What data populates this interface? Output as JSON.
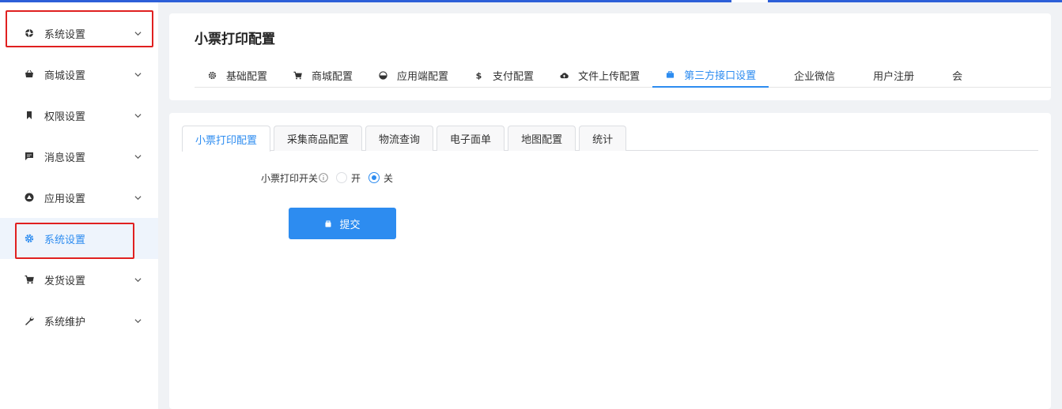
{
  "colors": {
    "accent": "#2d8cf0",
    "highlight_border": "#e02020",
    "topbar": "#2d5fd8"
  },
  "sidebar": {
    "items": [
      {
        "label": "系统设置",
        "icon": "aperture-icon",
        "has_chevron": true,
        "active": false
      },
      {
        "label": "商城设置",
        "icon": "basket-icon",
        "has_chevron": true,
        "active": false
      },
      {
        "label": "权限设置",
        "icon": "bookmark-icon",
        "has_chevron": true,
        "active": false
      },
      {
        "label": "消息设置",
        "icon": "message-icon",
        "has_chevron": true,
        "active": false
      },
      {
        "label": "应用设置",
        "icon": "compass-icon",
        "has_chevron": true,
        "active": false
      },
      {
        "label": "系统设置",
        "icon": "gear-icon",
        "has_chevron": false,
        "active": true
      },
      {
        "label": "发货设置",
        "icon": "cart-icon",
        "has_chevron": true,
        "active": false
      },
      {
        "label": "系统维护",
        "icon": "wrench-icon",
        "has_chevron": true,
        "active": false
      }
    ]
  },
  "header": {
    "title": "小票打印配置",
    "tabs": [
      {
        "label": "基础配置",
        "icon": "gear-icon"
      },
      {
        "label": "商城配置",
        "icon": "cart-icon"
      },
      {
        "label": "应用端配置",
        "icon": "dashboard-icon"
      },
      {
        "label": "支付配置",
        "icon": "dollar-icon"
      },
      {
        "label": "文件上传配置",
        "icon": "cloud-upload-icon"
      },
      {
        "label": "第三方接口设置",
        "icon": "briefcase-icon",
        "active": true
      },
      {
        "label": "企业微信"
      },
      {
        "label": "用户注册"
      },
      {
        "label": "会"
      }
    ]
  },
  "main": {
    "sub_tabs": [
      {
        "label": "小票打印配置",
        "active": true
      },
      {
        "label": "采集商品配置"
      },
      {
        "label": "物流查询"
      },
      {
        "label": "电子面单"
      },
      {
        "label": "地图配置"
      },
      {
        "label": "统计"
      }
    ],
    "form": {
      "switch_label": "小票打印开关",
      "option_on": "开",
      "option_off": "关",
      "selected": "关"
    },
    "submit_label": "提交"
  }
}
